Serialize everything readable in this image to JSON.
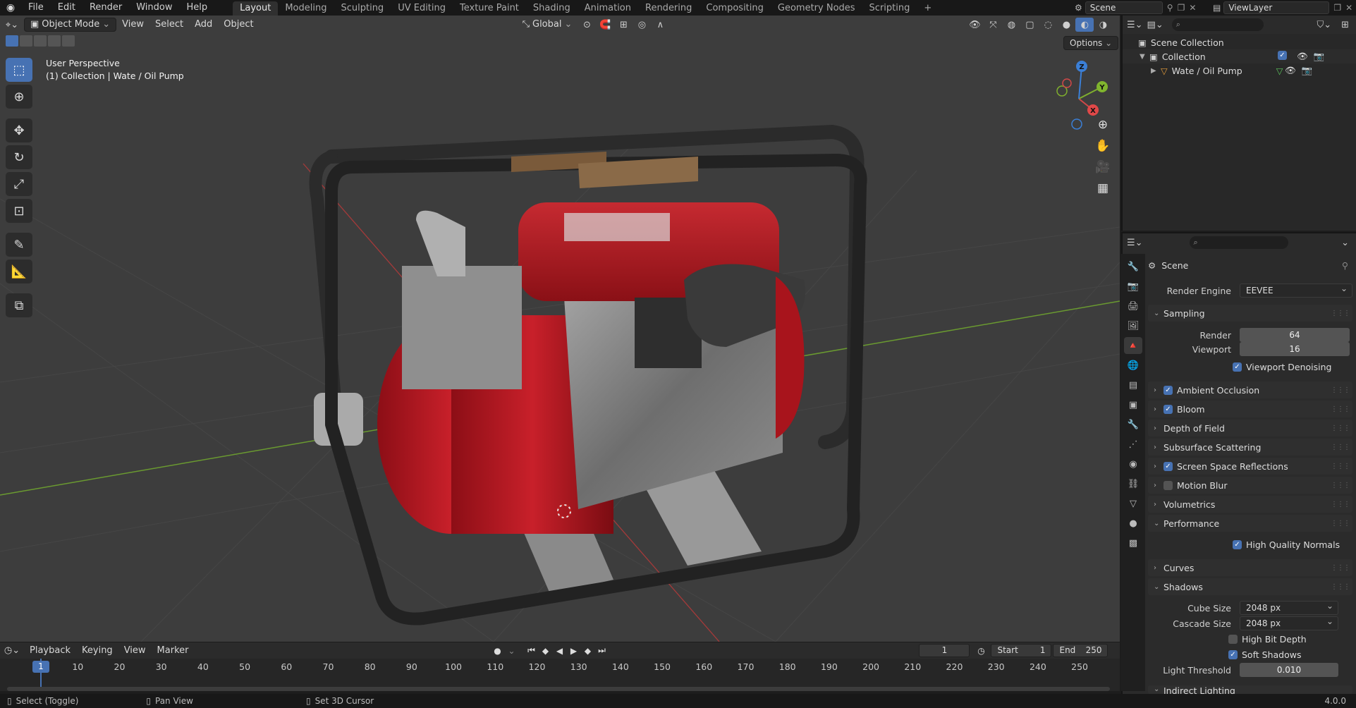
{
  "topbar": {
    "menus": [
      "File",
      "Edit",
      "Render",
      "Window",
      "Help"
    ],
    "workspaces": [
      "Layout",
      "Modeling",
      "Sculpting",
      "UV Editing",
      "Texture Paint",
      "Shading",
      "Animation",
      "Rendering",
      "Compositing",
      "Geometry Nodes",
      "Scripting"
    ],
    "active_workspace": "Layout",
    "add_workspace": "+",
    "scene": "Scene",
    "view_layer": "ViewLayer"
  },
  "viewport": {
    "mode": "Object Mode",
    "menus": [
      "View",
      "Select",
      "Add",
      "Object"
    ],
    "transform_orientation": "Global",
    "options": "Options",
    "overlay_title": "User Perspective",
    "overlay_collection": "(1) Collection | Wate / Oil  Pump",
    "gizmo": {
      "x": "X",
      "y": "Y",
      "z": "Z"
    }
  },
  "outliner": {
    "search_placeholder": "",
    "scene_collection": "Scene Collection",
    "collection": "Collection",
    "object": "Wate / Oil  Pump"
  },
  "properties": {
    "context": "Scene",
    "render_engine_label": "Render Engine",
    "render_engine": "EEVEE",
    "sampling": {
      "title": "Sampling",
      "render_label": "Render",
      "render": "64",
      "viewport_label": "Viewport",
      "viewport": "16",
      "denoise": "Viewport Denoising"
    },
    "panels": [
      {
        "label": "Ambient Occlusion",
        "checkbox": true,
        "checked": true
      },
      {
        "label": "Bloom",
        "checkbox": true,
        "checked": true
      },
      {
        "label": "Depth of Field",
        "checkbox": false
      },
      {
        "label": "Subsurface Scattering",
        "checkbox": false
      },
      {
        "label": "Screen Space Reflections",
        "checkbox": true,
        "checked": true
      },
      {
        "label": "Motion Blur",
        "checkbox": true,
        "checked": false
      },
      {
        "label": "Volumetrics",
        "checkbox": false
      }
    ],
    "performance": {
      "title": "Performance",
      "hq_normals": "High Quality Normals"
    },
    "curves": "Curves",
    "shadows": {
      "title": "Shadows",
      "cube_size_label": "Cube Size",
      "cube_size": "2048 px",
      "cascade_size_label": "Cascade Size",
      "cascade_size": "2048 px",
      "high_bit_depth": "High Bit Depth",
      "soft_shadows": "Soft Shadows",
      "light_threshold_label": "Light Threshold",
      "light_threshold": "0.010"
    },
    "indirect_lighting": "Indirect Lighting"
  },
  "timeline": {
    "menus": [
      "Playback",
      "Keying",
      "View",
      "Marker"
    ],
    "current_frame": "1",
    "start_label": "Start",
    "start": "1",
    "end_label": "End",
    "end": "250",
    "ticks": [
      "1",
      "10",
      "20",
      "30",
      "40",
      "50",
      "60",
      "70",
      "80",
      "90",
      "100",
      "110",
      "120",
      "130",
      "140",
      "150",
      "160",
      "170",
      "180",
      "190",
      "200",
      "210",
      "220",
      "230",
      "240",
      "250"
    ]
  },
  "statusbar": {
    "select": "Select (Toggle)",
    "pan": "Pan View",
    "cursor": "Set 3D Cursor",
    "version": "4.0.0"
  },
  "colors": {
    "accent": "#4772b3",
    "pump_red": "#b3141e",
    "viewport_bg": "#3d3d3d"
  }
}
